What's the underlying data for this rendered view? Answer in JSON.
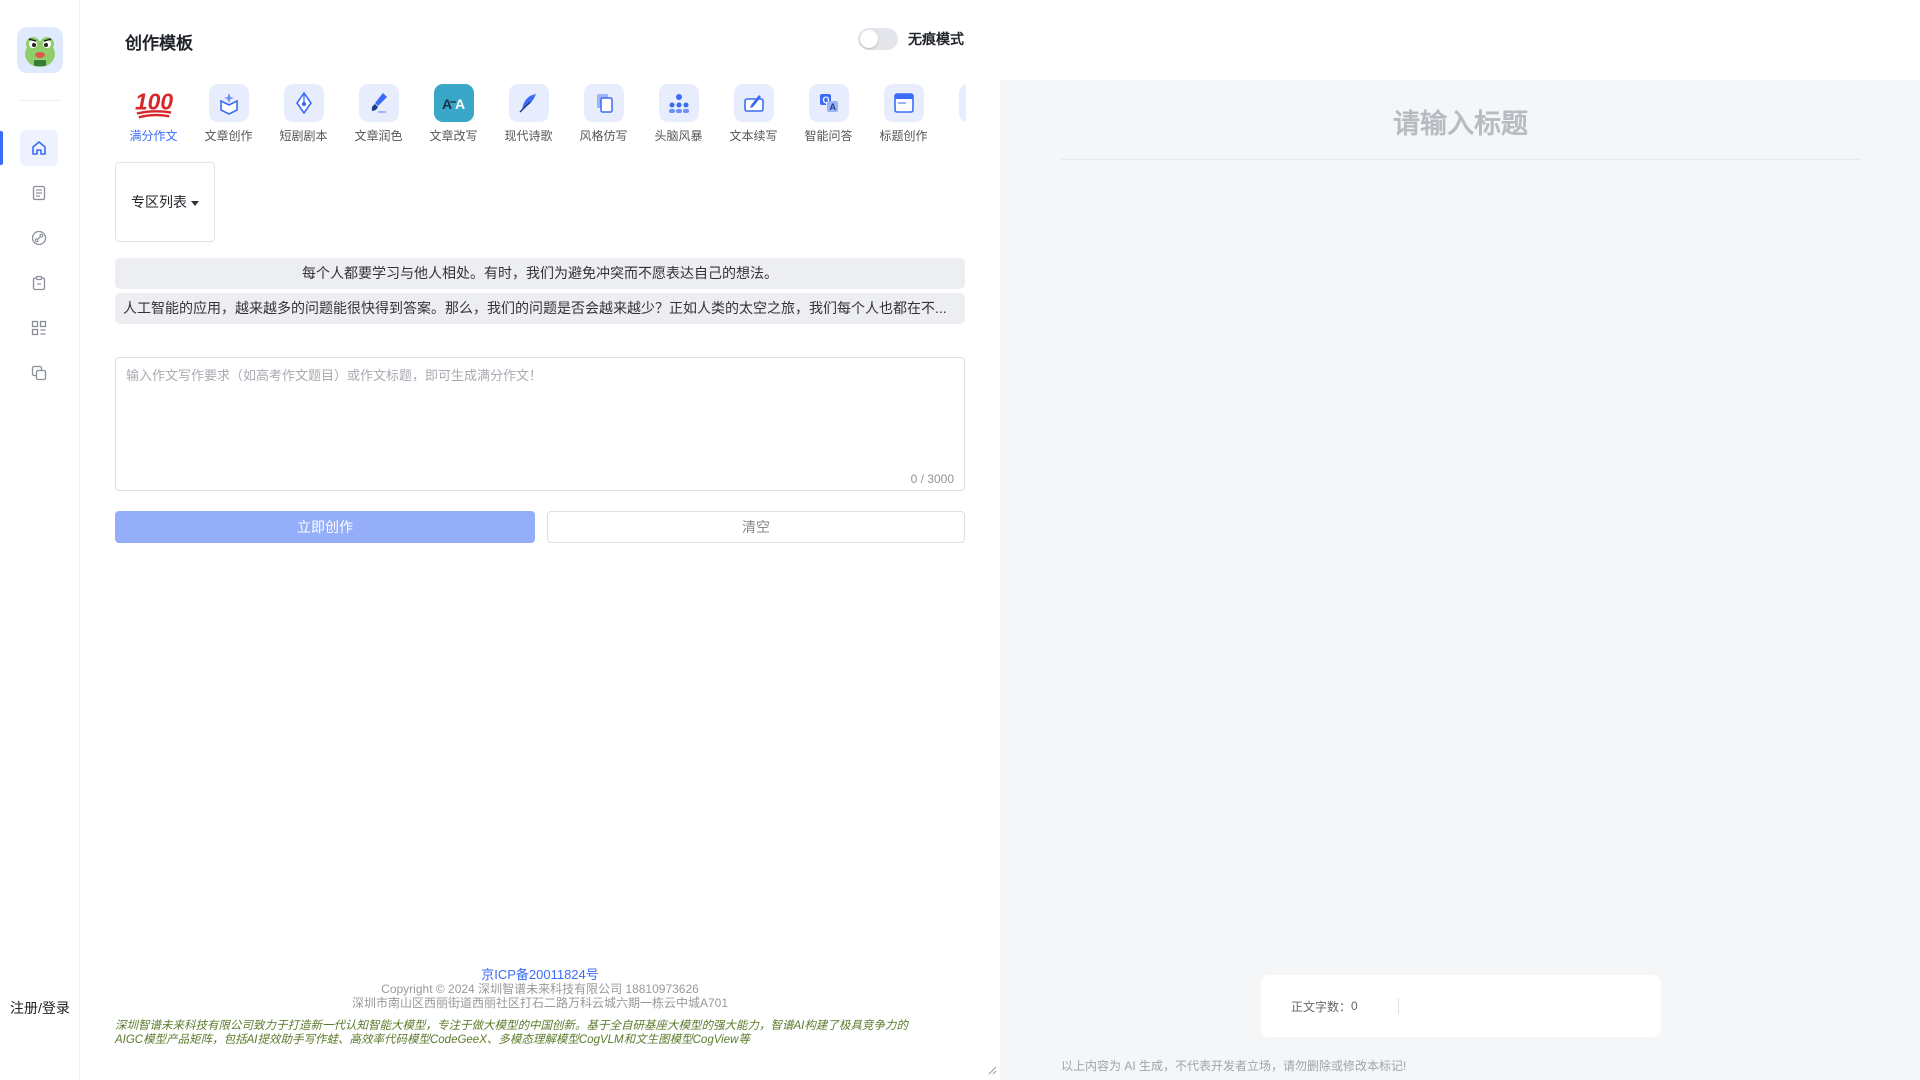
{
  "sidebar": {
    "login_label": "注册/登录",
    "nav_items": [
      {
        "icon": "home-icon",
        "active": true
      },
      {
        "icon": "document-list-icon",
        "active": false
      },
      {
        "icon": "link-icon",
        "active": false
      },
      {
        "icon": "clipboard-icon",
        "active": false
      },
      {
        "icon": "grid-apps-icon",
        "active": false
      },
      {
        "icon": "copy-icon",
        "active": false
      }
    ]
  },
  "header": {
    "title": "创作模板",
    "incognito_label": "无痕模式"
  },
  "templates": [
    {
      "label": "满分作文",
      "icon": "hundred-points-icon",
      "active": true
    },
    {
      "label": "文章创作",
      "icon": "box-sparkle-icon"
    },
    {
      "label": "短剧剧本",
      "icon": "pen-nib-icon"
    },
    {
      "label": "文章润色",
      "icon": "brush-icon"
    },
    {
      "label": "文章改写",
      "icon": "translate-ab-icon"
    },
    {
      "label": "现代诗歌",
      "icon": "feather-icon"
    },
    {
      "label": "风格仿写",
      "icon": "pages-copy-icon"
    },
    {
      "label": "头脑风暴",
      "icon": "people-group-icon"
    },
    {
      "label": "文本续写",
      "icon": "edit-continue-icon"
    },
    {
      "label": "智能问答",
      "icon": "qa-icon"
    },
    {
      "label": "标题创作",
      "icon": "window-title-icon"
    },
    {
      "label": "文章",
      "icon": "partial-icon"
    }
  ],
  "zone_list_label": "专区列表",
  "examples": [
    "每个人都要学习与他人相处。有时，我们为避免冲突而不愿表达自己的想法。",
    "人工智能的应用，越来越多的问题能很快得到答案。那么，我们的问题是否会越来越少？正如人类的太空之旅，我们每个人也都在不..."
  ],
  "input": {
    "placeholder": "输入作文写作要求（如高考作文题目）或作文标题，即可生成满分作文！",
    "value": "",
    "counter": "0 / 3000"
  },
  "actions": {
    "create_label": "立即创作",
    "clear_label": "清空"
  },
  "footer": {
    "icp": "京ICP备20011824号",
    "copyright": "Copyright © 2024 深圳智谱未来科技有限公司 18810973626",
    "address": "深圳市南山区西丽街道西丽社区打石二路万科云城六期一栋云中城A701",
    "tagline_1": "深圳智谱未来科技有限公司致力于打造新一代认知智能大模型，专注于做大模型的中国创新。基于全自研基座大模型的强大能力，智谱AI构建了极具竞争力的",
    "tagline_2": "AIGC模型产品矩阵，包括AI提效助手写作蛙、高效率代码模型CodeGeeX、多模态理解模型CogVLM和文生图模型CogView等"
  },
  "editor": {
    "title_placeholder": "请输入标题",
    "word_count_label": "正文字数：",
    "word_count_value": "0",
    "disclaimer": "以上内容为 AI 生成，不代表开发者立场，请勿删除或修改本标记!"
  },
  "colors": {
    "accent": "#3b6cf6",
    "primary_button": "#94aef9",
    "panel_bg": "#f5f6f8"
  }
}
